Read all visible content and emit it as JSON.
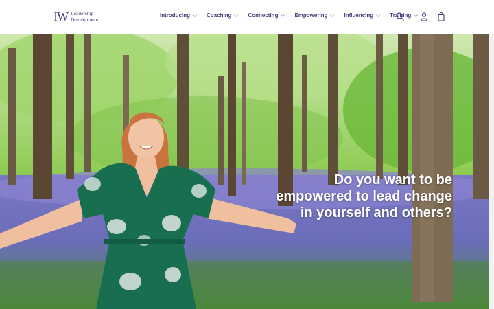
{
  "brand": {
    "mark_i": "I",
    "mark_w": "W",
    "line1": "Leadership",
    "line2": "Development"
  },
  "nav": {
    "items": [
      {
        "label": "Introducing"
      },
      {
        "label": "Coaching"
      },
      {
        "label": "Connecting"
      },
      {
        "label": "Empowering"
      },
      {
        "label": "Influencing"
      },
      {
        "label": "Training"
      }
    ]
  },
  "icons": [
    "search-icon",
    "user-icon",
    "cart-bag-icon"
  ],
  "hero": {
    "headline": "Do you want to be empowered to lead change in yourself and others?"
  },
  "colors": {
    "brand": "#3c3f78",
    "accent": "#6b6fa6",
    "foliage": "#7cc04a",
    "bluebell": "#7a74c8"
  }
}
